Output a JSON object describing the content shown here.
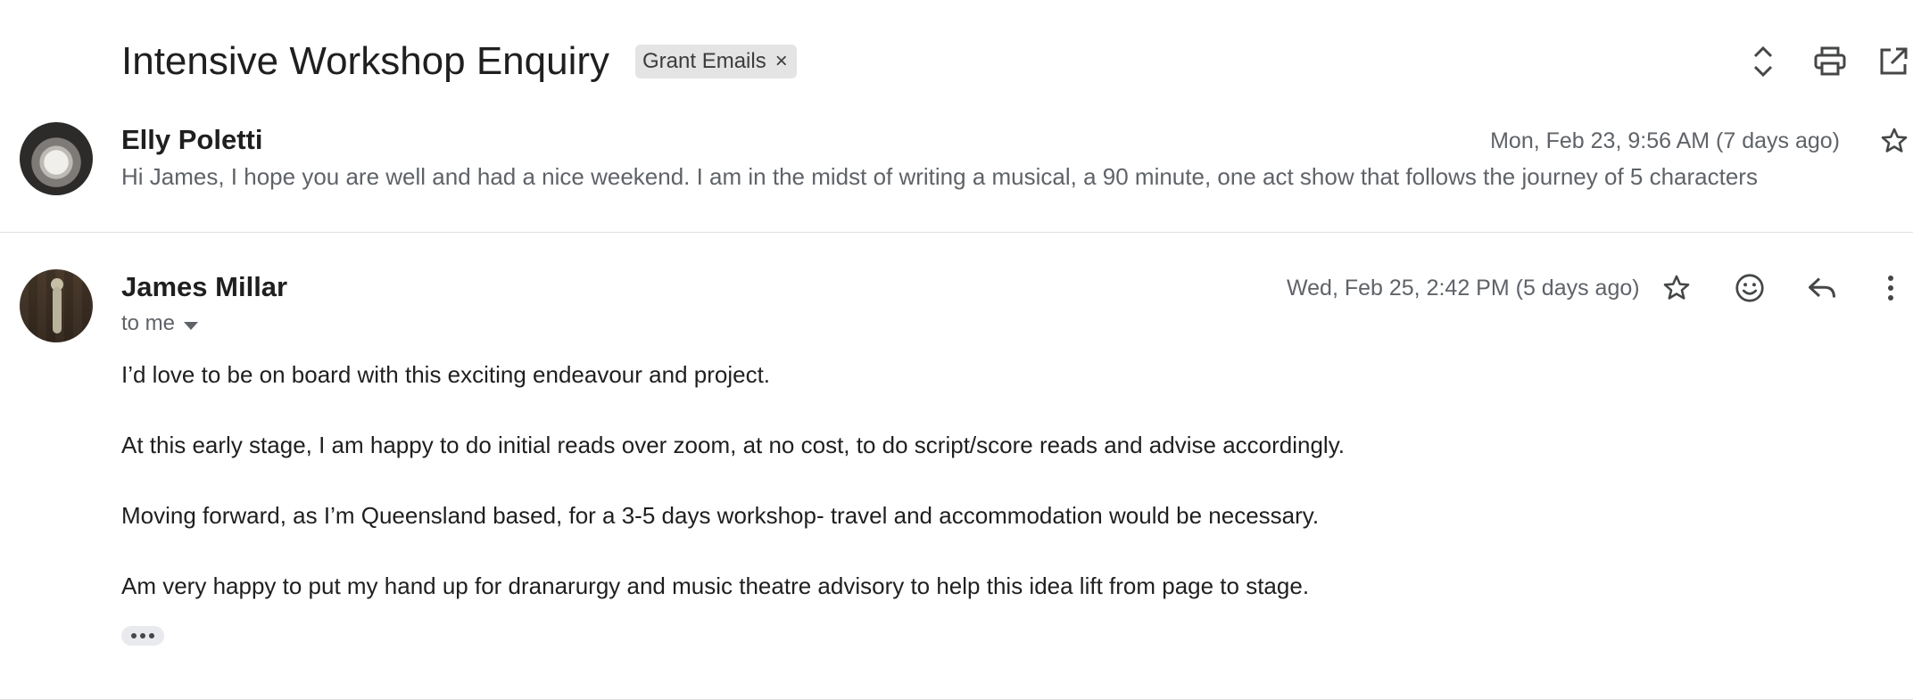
{
  "thread": {
    "subject": "Intensive Workshop Enquiry",
    "label": "Grant Emails",
    "label_remove": "×"
  },
  "header_icons": [
    "expand-collapse-icon",
    "print-icon",
    "open-in-new-window-icon"
  ],
  "messages": [
    {
      "sender": "Elly Poletti",
      "date": "Mon, Feb 23, 9:56 AM (7 days ago)",
      "snippet": "Hi James, I hope you are well and had a nice weekend. I am in the midst of writing a musical, a 90 minute, one act show that follows the journey of 5 characters",
      "collapsed": true
    },
    {
      "sender": "James Millar",
      "date": "Wed, Feb 25, 2:42 PM (5 days ago)",
      "recipient": "to me",
      "body": [
        "I’d love to be on board with this exciting endeavour and project.",
        "At this early stage, I am happy to do initial reads over zoom, at no cost, to do script/score reads and advise accordingly.",
        "Moving forward, as I’m Queensland based, for a 3-5 days workshop- travel and accommodation would be necessary.",
        "Am very happy to put my hand up for dranarurgy and music theatre advisory to help this idea lift from page to stage."
      ]
    }
  ],
  "colors": {
    "text_primary": "#1f1f1f",
    "text_secondary": "#5f6368",
    "chip_bg": "#e4e4e4",
    "divider": "#e0e0e0"
  }
}
